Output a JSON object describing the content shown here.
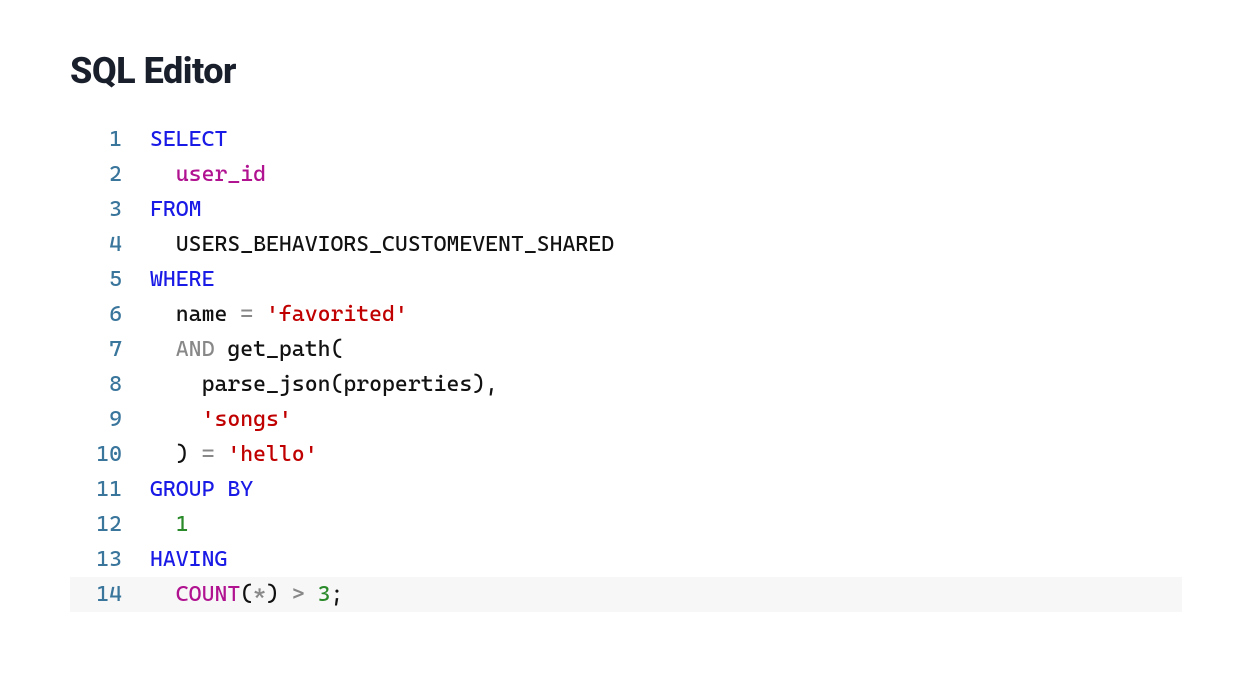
{
  "title": "SQL Editor",
  "activeLine": 14,
  "lines": [
    {
      "num": "1",
      "tokens": [
        {
          "t": "SELECT",
          "c": "kw"
        }
      ]
    },
    {
      "num": "2",
      "tokens": [
        {
          "t": "  ",
          "c": "guide"
        },
        {
          "t": "user_id",
          "c": "ident"
        }
      ]
    },
    {
      "num": "3",
      "tokens": [
        {
          "t": "FROM",
          "c": "kw"
        }
      ]
    },
    {
      "num": "4",
      "tokens": [
        {
          "t": "  ",
          "c": "guide"
        },
        {
          "t": "USERS_BEHAVIORS_CUSTOMEVENT_SHARED",
          "c": "plain"
        }
      ]
    },
    {
      "num": "5",
      "tokens": [
        {
          "t": "WHERE",
          "c": "kw"
        }
      ]
    },
    {
      "num": "6",
      "tokens": [
        {
          "t": "  ",
          "c": "guide"
        },
        {
          "t": "name ",
          "c": "plain"
        },
        {
          "t": "=",
          "c": "op"
        },
        {
          "t": " ",
          "c": "plain"
        },
        {
          "t": "'favorited'",
          "c": "str"
        }
      ]
    },
    {
      "num": "7",
      "tokens": [
        {
          "t": "  ",
          "c": "guide"
        },
        {
          "t": "AND",
          "c": "op"
        },
        {
          "t": " get_path(",
          "c": "plain"
        }
      ]
    },
    {
      "num": "8",
      "tokens": [
        {
          "t": "    ",
          "c": "guide"
        },
        {
          "t": "parse_json(properties),",
          "c": "plain"
        }
      ]
    },
    {
      "num": "9",
      "tokens": [
        {
          "t": "    ",
          "c": "guide"
        },
        {
          "t": "'songs'",
          "c": "str"
        }
      ]
    },
    {
      "num": "10",
      "tokens": [
        {
          "t": "  ",
          "c": "guide"
        },
        {
          "t": ") ",
          "c": "plain"
        },
        {
          "t": "=",
          "c": "op"
        },
        {
          "t": " ",
          "c": "plain"
        },
        {
          "t": "'hello'",
          "c": "str"
        }
      ]
    },
    {
      "num": "11",
      "tokens": [
        {
          "t": "GROUP BY",
          "c": "kw"
        }
      ]
    },
    {
      "num": "12",
      "tokens": [
        {
          "t": "  ",
          "c": "guide"
        },
        {
          "t": "1",
          "c": "num"
        }
      ]
    },
    {
      "num": "13",
      "tokens": [
        {
          "t": "HAVING",
          "c": "kw"
        }
      ]
    },
    {
      "num": "14",
      "tokens": [
        {
          "t": "  ",
          "c": "guide"
        },
        {
          "t": "COUNT",
          "c": "ident"
        },
        {
          "t": "(",
          "c": "plain"
        },
        {
          "t": "*",
          "c": "op"
        },
        {
          "t": ") ",
          "c": "plain"
        },
        {
          "t": ">",
          "c": "op"
        },
        {
          "t": " ",
          "c": "plain"
        },
        {
          "t": "3",
          "c": "num"
        },
        {
          "t": ";",
          "c": "plain"
        }
      ]
    }
  ]
}
